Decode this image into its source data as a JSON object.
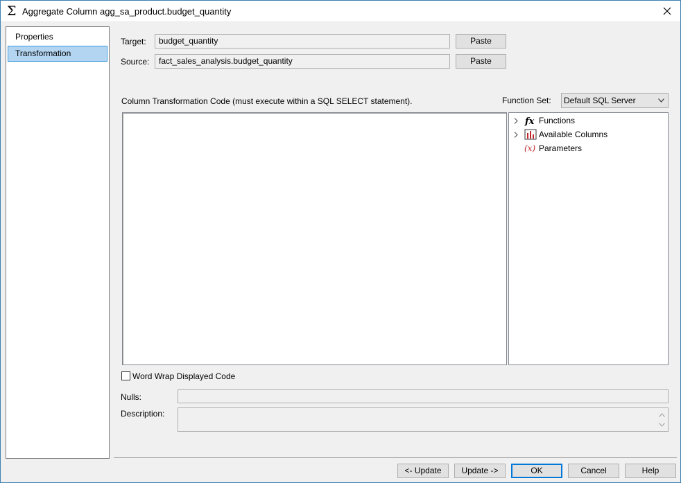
{
  "window": {
    "title_icon": "Σ",
    "title": "Aggregate Column agg_sa_product.budget_quantity"
  },
  "sidebar": {
    "items": [
      {
        "label": "Properties"
      },
      {
        "label": "Transformation"
      }
    ],
    "selected_index": 1
  },
  "target": {
    "label": "Target:",
    "value": "budget_quantity",
    "paste_label": "Paste"
  },
  "source": {
    "label": "Source:",
    "value": "fact_sales_analysis.budget_quantity",
    "paste_label": "Paste"
  },
  "code": {
    "label": "Column Transformation Code (must execute within a SQL SELECT statement).",
    "value": ""
  },
  "function_set": {
    "label": "Function Set:",
    "selected": "Default SQL Server"
  },
  "tree": {
    "nodes": [
      {
        "label": "Functions",
        "icon": "fx-icon",
        "expandable": true
      },
      {
        "label": "Available Columns",
        "icon": "columns-chart-icon",
        "expandable": true
      },
      {
        "label": "Parameters",
        "icon": "parameters-icon",
        "expandable": false
      }
    ]
  },
  "word_wrap": {
    "label": "Word Wrap Displayed Code",
    "checked": false
  },
  "nulls": {
    "label": "Nulls:",
    "value": ""
  },
  "description": {
    "label": "Description:",
    "value": ""
  },
  "buttons": {
    "update_prev": "<- Update",
    "update_next": "Update ->",
    "ok": "OK",
    "cancel": "Cancel",
    "help": "Help"
  },
  "colors": {
    "selection": "#b3d5f1",
    "selection_border": "#3c9ad8",
    "window_border": "#3c7fb1",
    "accent": "#0078d7",
    "columns_icon_red": "#c0282d"
  }
}
